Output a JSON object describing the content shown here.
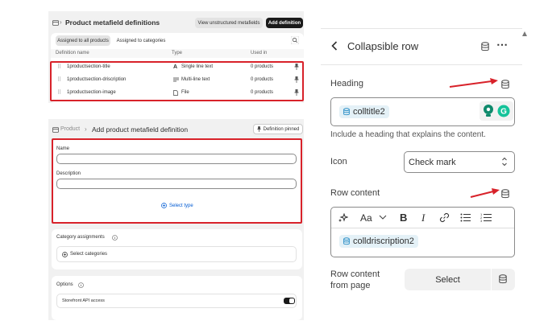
{
  "metafields": {
    "title": "Product metafield definitions",
    "unstructured_btn": "View unstructured metafields",
    "add_btn": "Add definition",
    "tabs": [
      "Assigned to all products",
      "Assigned to categories"
    ],
    "columns": [
      "Definition name",
      "Type",
      "Used in"
    ],
    "rows": [
      {
        "name": "1productsection-title",
        "type_icon": "A",
        "type": "Single line text",
        "used": "0 products"
      },
      {
        "name": "1productsection-driscription",
        "type_icon": "lines",
        "type": "Multi-line text",
        "used": "0 products"
      },
      {
        "name": "1productsection-image",
        "type_icon": "file",
        "type": "File",
        "used": "0 products"
      }
    ]
  },
  "add_def": {
    "breadcrumb": "Product",
    "separator": "›",
    "title": "Add product metafield definition",
    "pinned_btn": "Definition pinned",
    "name_label": "Name",
    "desc_label": "Description",
    "select_type": "Select type",
    "category_title": "Category assignments",
    "select_categories": "Select categories",
    "options_title": "Options",
    "storefront": "Storefront API access"
  },
  "editor": {
    "title": "Collapsible row",
    "heading_label": "Heading",
    "heading_value": "colltitle2",
    "heading_help": "Include a heading that explains the content.",
    "icon_label": "Icon",
    "icon_value": "Check mark",
    "row_content_label": "Row content",
    "row_content_value": "colldriscription2",
    "from_page_label": "Row content from page",
    "select_btn": "Select",
    "toolbar_aa": "Aa",
    "toolbar_b": "B",
    "toolbar_i": "I"
  },
  "colors": {
    "highlight_red": "#d8222a",
    "accent_green": "#0f8a6c",
    "chip_bg": "#e4f1f7",
    "chip_icon": "#2b8fc7"
  }
}
